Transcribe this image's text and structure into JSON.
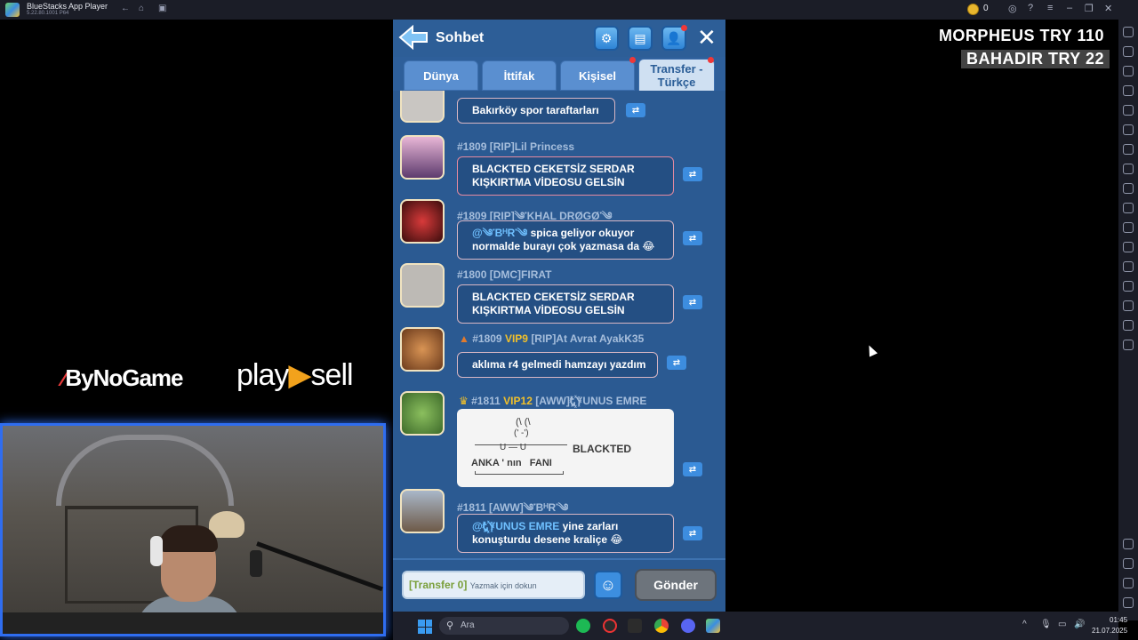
{
  "window": {
    "title": "BlueStacks App Player",
    "version": "5.22.80.1001 P64",
    "coin_count": "0"
  },
  "overlay": {
    "line1": "MORPHEUS  TRY 110",
    "line2": "BAHADIR  TRY 22",
    "brand1": "ByNoGame",
    "brand2_a": "play",
    "brand2_b": "sell"
  },
  "game": {
    "title": "Sohbet",
    "tabs": [
      "Dünya",
      "İttifak",
      "Kişisel",
      "Transfer -\nTürkçe"
    ],
    "active_tab": "Transfer - Türkçe",
    "messages": [
      {
        "name": "",
        "text": "Bakırköy spor taraftarları"
      },
      {
        "name": "#1809 [RIP]Lil Princess",
        "text": "BLACKTED CEKETSİZ SERDAR\nKIŞKIRTMA VİDEOSU GELSİN"
      },
      {
        "name": "#1809 [RIP]༄་KHAL DRØGØ་༄",
        "mention": "@༄་BᴴR་༄",
        "text": " spica geliyor okuyor\nnormalde burayı çok yazmasa da 😂"
      },
      {
        "name": "#1800 [DMC]FIRAT",
        "text": "BLACKTED CEKETSİZ SERDAR\nKIŞKIRTMA VİDEOSU GELSİN"
      },
      {
        "name": "#1809",
        "vip": "VIP9",
        "name_rest": "[RIP]At Avrat AyakK35",
        "text": "aklıma r4 gelmedi hamzayı yazdım"
      },
      {
        "name": "#1811",
        "vip": "VIP12",
        "name_rest": "[AWW]Ꮏ꙰YUNUS EMRE",
        "ascii_art": [
          "(\\ (\\",
          "(' -')",
          "U — U",
          "ANKA ' nın   FANI"
        ],
        "text": "BLACKTED"
      },
      {
        "name": "#1811 [AWW]༄་BᴴR་༄",
        "mention": "@Ꮏ꙰YUNUS EMRE",
        "text": " yine zarları\nkonuşturdu desene kraliçe 😂"
      }
    ],
    "input_prefix": "[Transfer 0]",
    "input_placeholder": "Yazmak için dokun",
    "send_label": "Gönder",
    "transfer_icon": "⇄"
  },
  "taskbar": {
    "search_placeholder": "Ara",
    "time": "01:45",
    "date": "21.07.2025"
  },
  "colors": {
    "accent": "#2e5f9a",
    "tab_active": "#cfe0f2",
    "webcam_border": "#2f6df0"
  }
}
